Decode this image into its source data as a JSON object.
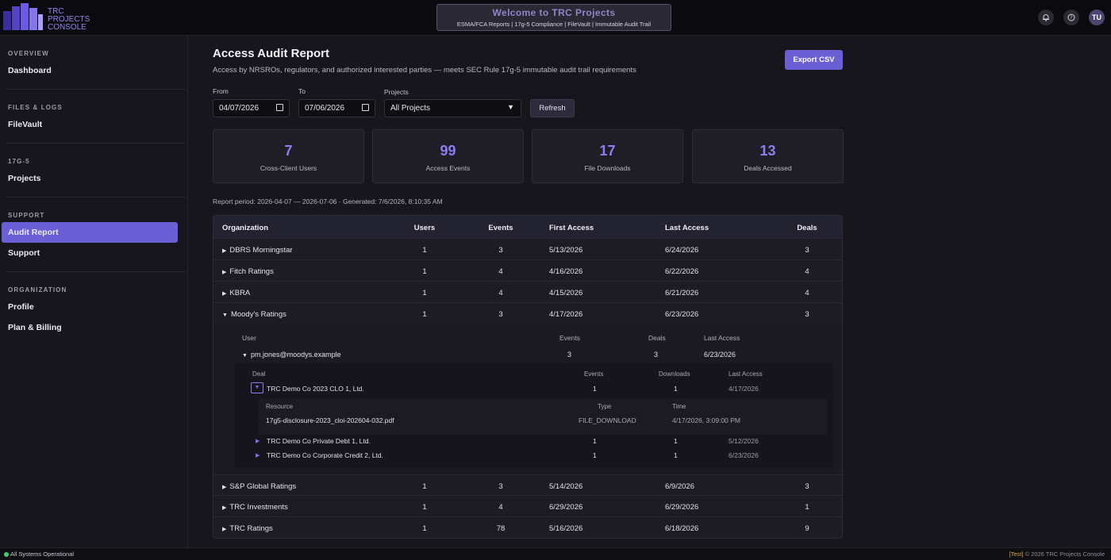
{
  "header": {
    "logo_lines": [
      "TRC",
      "PROJECTS",
      "CONSOLE"
    ],
    "welcome_title": "Welcome to TRC Projects",
    "welcome_subtitle": "ESMA/FCA Reports | 17g-5 Compliance | FileVault | Immutable Audit Trail",
    "icons": [
      "bell-icon",
      "help-icon"
    ],
    "avatar": "TU"
  },
  "sidebar": {
    "sections": [
      {
        "title": "OVERVIEW",
        "items": [
          "Dashboard"
        ]
      },
      {
        "title": "FILES & LOGS",
        "items": [
          "FileVault"
        ]
      },
      {
        "title": "17G-5",
        "items": [
          "Projects"
        ]
      },
      {
        "title": "SUPPORT",
        "items": [
          "Audit Report",
          "Support"
        ]
      },
      {
        "title": "ORGANIZATION",
        "items": [
          "Profile",
          "Plan & Billing"
        ]
      }
    ],
    "active": "Audit Report"
  },
  "page": {
    "title": "Access Audit Report",
    "subtitle": "Access by NRSROs, regulators, and authorized interested parties — meets SEC Rule 17g-5 immutable audit trail requirements",
    "export_label": "Export CSV"
  },
  "filters": {
    "from_label": "From",
    "from_value": "04/07/2026",
    "to_label": "To",
    "to_value": "07/06/2026",
    "projects_label": "Projects",
    "projects_value": "All Projects",
    "refresh_label": "Refresh"
  },
  "stats": [
    {
      "value": "7",
      "label": "Cross-Client Users"
    },
    {
      "value": "99",
      "label": "Access Events"
    },
    {
      "value": "17",
      "label": "File Downloads"
    },
    {
      "value": "13",
      "label": "Deals Accessed"
    }
  ],
  "report_period": "Report period: 2026-04-07 — 2026-07-06 · Generated: 7/6/2026, 8:10:35 AM",
  "table": {
    "headers": {
      "org": "Organization",
      "users": "Users",
      "events": "Events",
      "first": "First Access",
      "last": "Last Access",
      "deals": "Deals"
    },
    "rows": [
      {
        "org": "DBRS Morningstar",
        "users": "1",
        "events": "3",
        "first": "5/13/2026",
        "last": "6/24/2026",
        "deals": "3",
        "arrow": "▶"
      },
      {
        "org": "Fitch Ratings",
        "users": "1",
        "events": "4",
        "first": "4/16/2026",
        "last": "6/22/2026",
        "deals": "4",
        "arrow": "▶"
      },
      {
        "org": "KBRA",
        "users": "1",
        "events": "4",
        "first": "4/15/2026",
        "last": "6/21/2026",
        "deals": "4",
        "arrow": "▶"
      },
      {
        "org": "Moody's Ratings",
        "users": "1",
        "events": "3",
        "first": "4/17/2026",
        "last": "6/23/2026",
        "deals": "3",
        "arrow": "▼"
      },
      {
        "org": "S&P Global Ratings",
        "users": "1",
        "events": "3",
        "first": "5/14/2026",
        "last": "6/9/2026",
        "deals": "3",
        "arrow": "▶"
      },
      {
        "org": "TRC Investments",
        "users": "1",
        "events": "4",
        "first": "6/29/2026",
        "last": "6/29/2026",
        "deals": "1",
        "arrow": "▶"
      },
      {
        "org": "TRC Ratings",
        "users": "1",
        "events": "78",
        "first": "5/16/2026",
        "last": "6/18/2026",
        "deals": "9",
        "arrow": "▶"
      }
    ],
    "expanded": {
      "user_headers": {
        "user": "User",
        "events": "Events",
        "deals": "Deals",
        "last": "Last Access"
      },
      "user": {
        "email": "pm.jones@moodys.example",
        "events": "3",
        "deals": "3",
        "last": "6/23/2026",
        "arrow": "▼"
      },
      "deal_headers": {
        "deal": "Deal",
        "events": "Events",
        "downloads": "Downloads",
        "last": "Last Access"
      },
      "deals": [
        {
          "name": "TRC Demo Co 2023 CLO 1, Ltd.",
          "events": "1",
          "downloads": "1",
          "last": "4/17/2026",
          "arrow": "▼"
        },
        {
          "name": "TRC Demo Co Private Debt 1, Ltd.",
          "events": "1",
          "downloads": "1",
          "last": "5/12/2026",
          "arrow": "▶"
        },
        {
          "name": "TRC Demo Co Corporate Credit 2, Ltd.",
          "events": "1",
          "downloads": "1",
          "last": "6/23/2026",
          "arrow": "▶"
        }
      ],
      "resource_headers": {
        "resource": "Resource",
        "type": "Type",
        "time": "Time"
      },
      "resource": {
        "name": "17g5-disclosure-2023_cloi-202604-032.pdf",
        "type": "FILE_DOWNLOAD",
        "time": "4/17/2026, 3:09:00 PM"
      }
    }
  },
  "footer": {
    "status": "All Systems Operational",
    "tag": "[Test]",
    "copyright": "© 2026 TRC Projects Console"
  },
  "colors": {
    "accent": "#6b5fd6",
    "stat_value": "#8a7ff0",
    "status_ok": "#3ccf6e"
  }
}
